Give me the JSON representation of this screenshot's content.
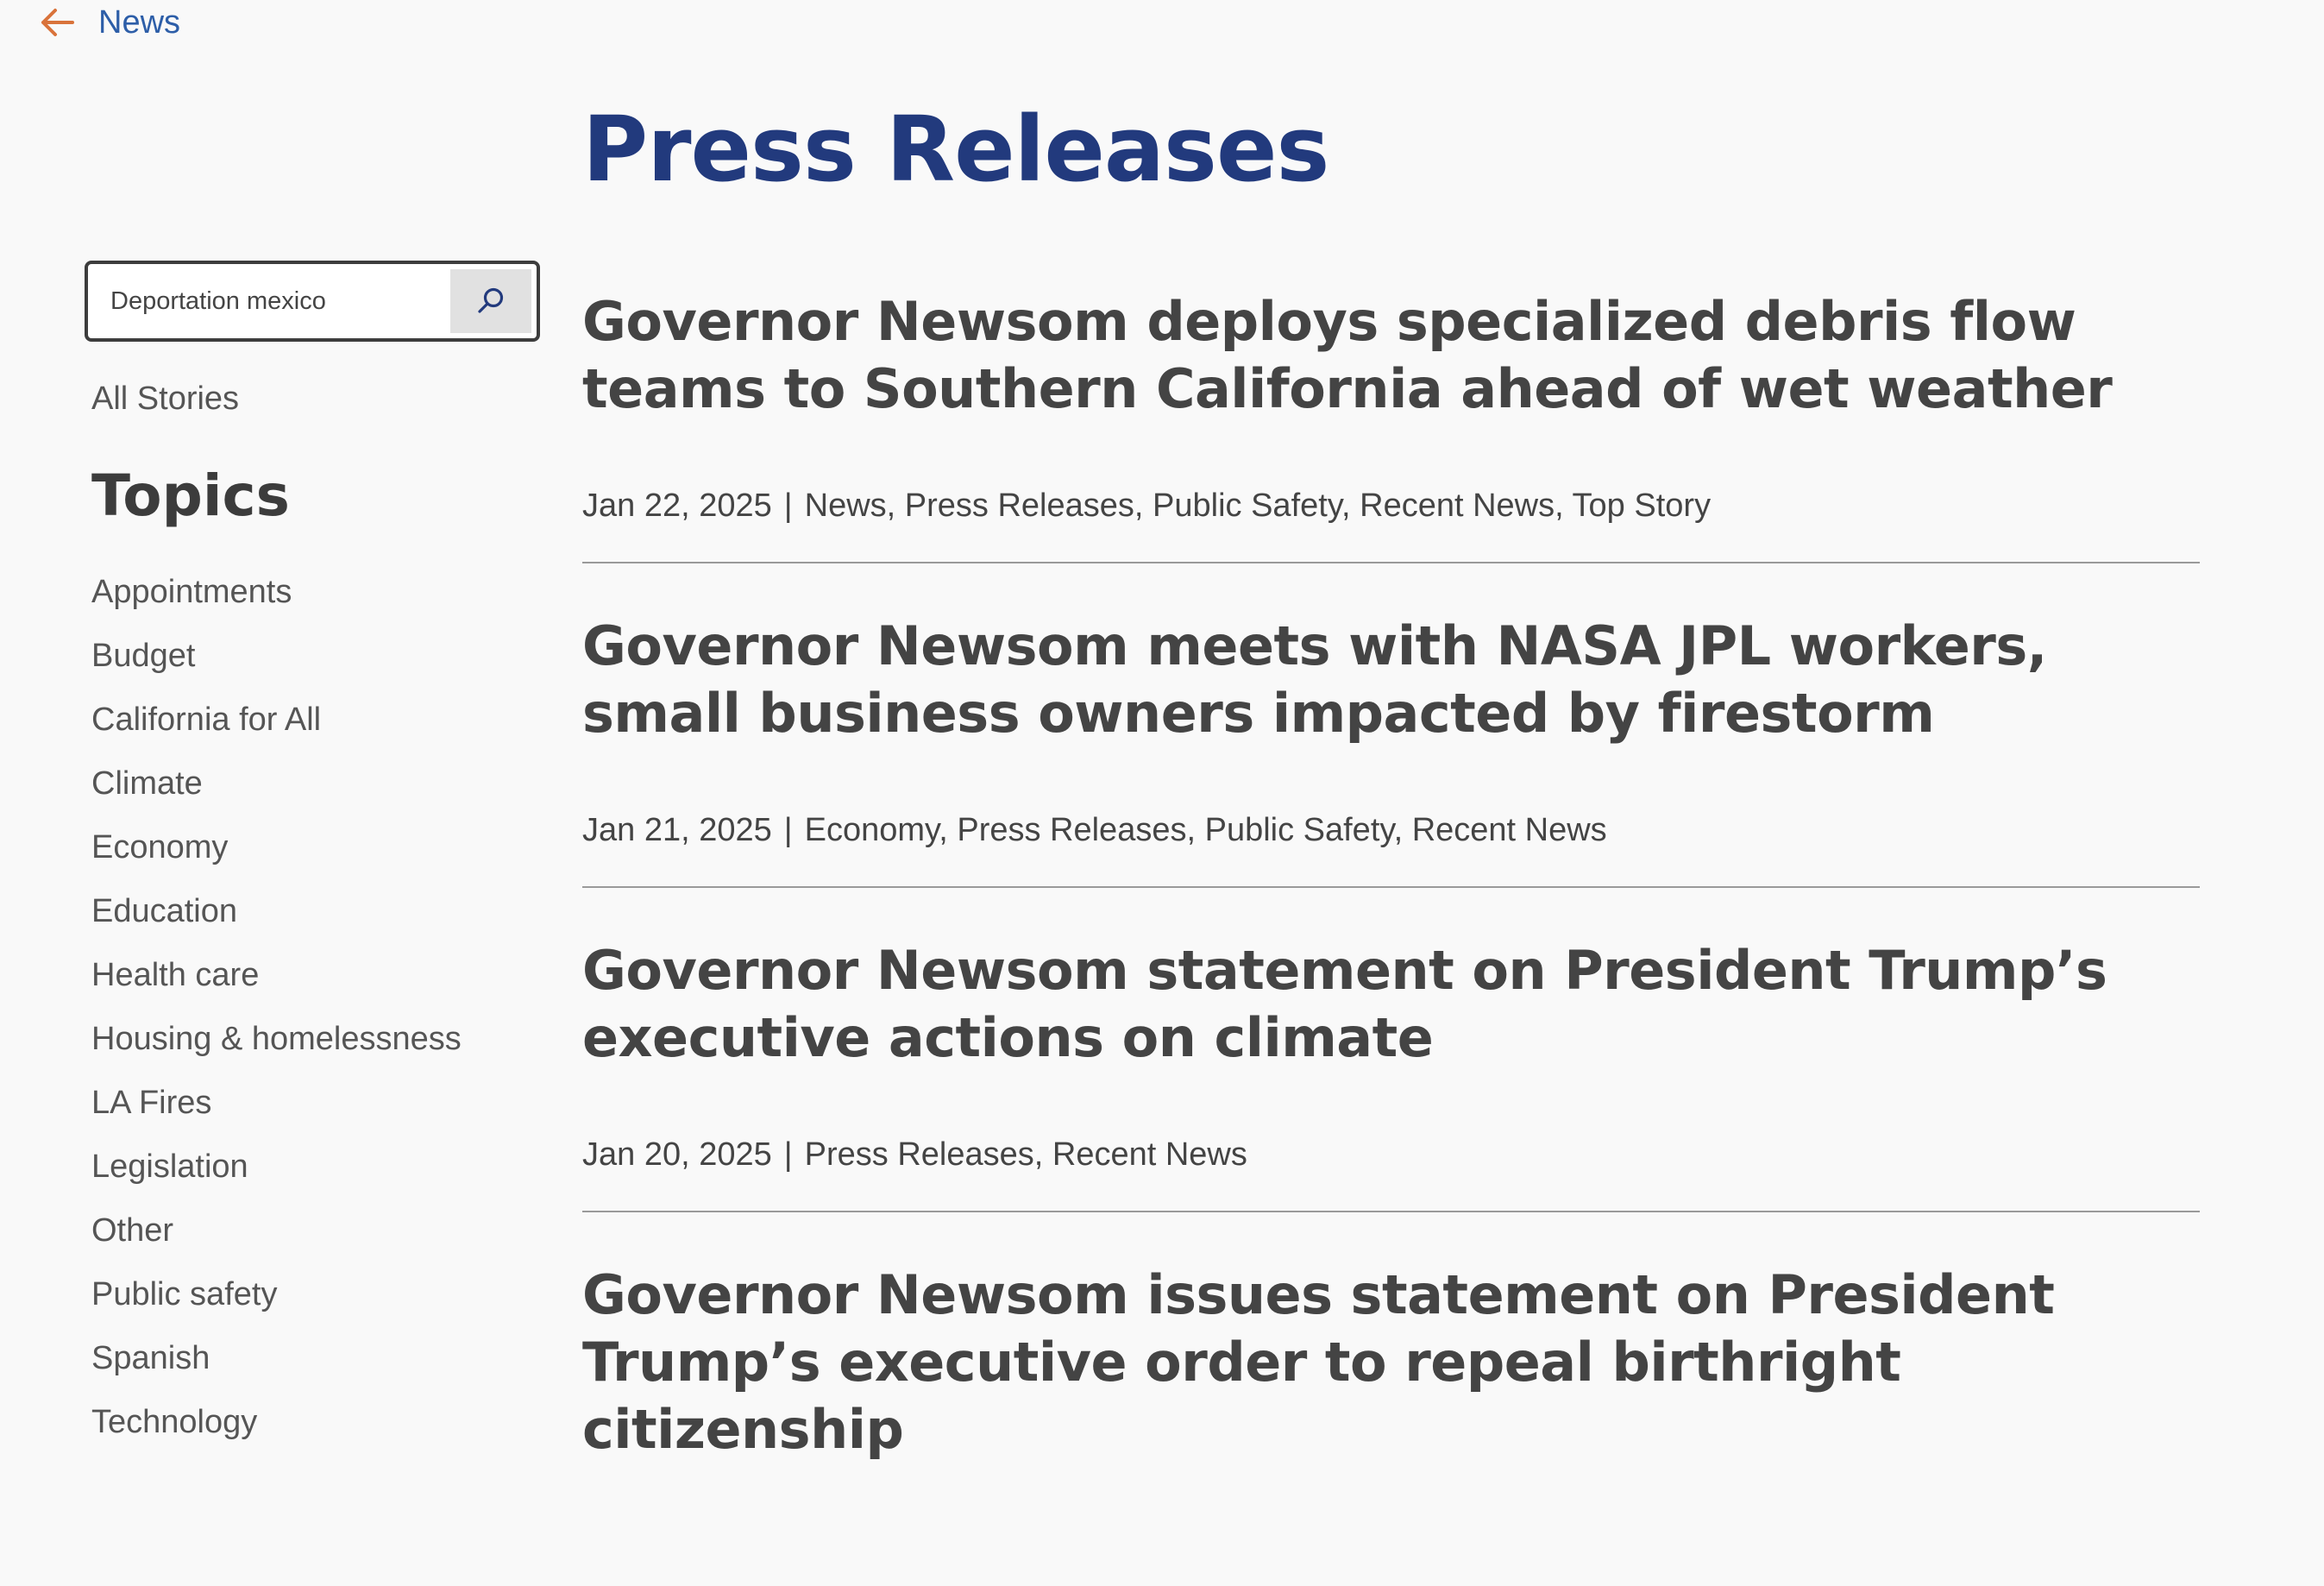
{
  "nav": {
    "back_label": "News"
  },
  "page": {
    "title": "Press Releases"
  },
  "search": {
    "value": "Deportation mexico",
    "placeholder": ""
  },
  "sidebar": {
    "all_stories": "All Stories",
    "topics_heading": "Topics",
    "topics": [
      "Appointments",
      "Budget",
      "California for All",
      "Climate",
      "Economy",
      "Education",
      "Health care",
      "Housing & homelessness",
      "LA Fires",
      "Legislation",
      "Other",
      "Public safety",
      "Spanish",
      "Technology"
    ]
  },
  "articles": [
    {
      "title": "Governor Newsom deploys specialized debris flow teams to Southern California ahead of wet weather",
      "date": "Jan 22, 2025",
      "categories": [
        "News",
        "Press Releases",
        "Public Safety",
        "Recent News",
        "Top Story"
      ]
    },
    {
      "title": "Governor Newsom meets with NASA JPL workers, small business owners impacted by firestorm",
      "date": "Jan 21, 2025",
      "categories": [
        "Economy",
        "Press Releases",
        "Public Safety",
        "Recent News"
      ]
    },
    {
      "title": "Governor Newsom statement on President Trump’s executive actions on climate",
      "date": "Jan 20, 2025",
      "categories": [
        "Press Releases",
        "Recent News"
      ]
    },
    {
      "title": "Governor Newsom issues statement on President Trump’s executive order to repeal birthright citizenship",
      "date": "",
      "categories": []
    }
  ],
  "meta_separator": "|",
  "category_separator": ", ",
  "colors": {
    "title": "#223a7d",
    "link": "#2d5ea8",
    "back_arrow": "#d9733b",
    "heading_text": "#444444",
    "body_text": "#555555",
    "background": "#f9f9f9"
  },
  "icons": {
    "back": "arrow-left-icon",
    "search": "search-icon"
  }
}
